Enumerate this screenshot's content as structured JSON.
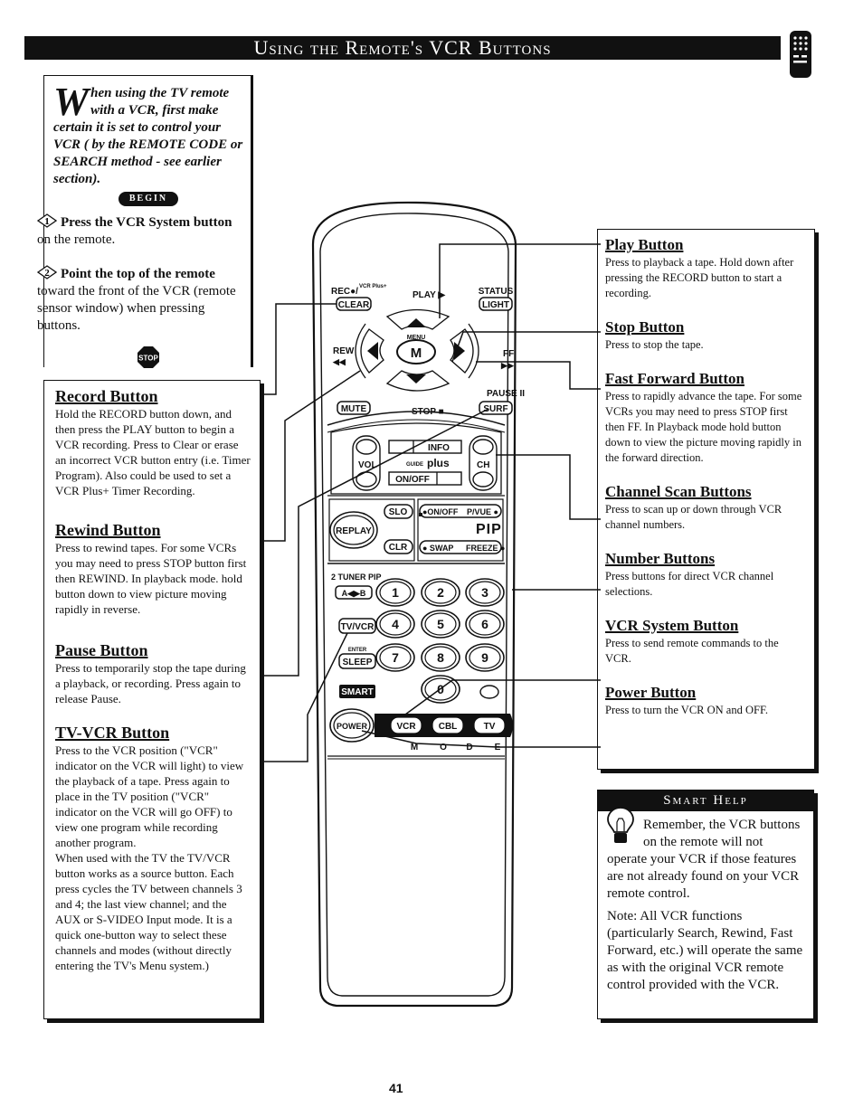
{
  "header": {
    "title": "Using the Remote's VCR Buttons",
    "icon": "remote-control-icon"
  },
  "intro": {
    "dropcap": "W",
    "text": "hen using the TV remote with a VCR, first make certain it is set to control your VCR ( by the REMOTE CODE or SEARCH method - see earlier section).",
    "begin_label": "BEGIN",
    "steps": [
      {
        "number": "1",
        "bold": "Press the VCR System button",
        "rest": " on the remote."
      },
      {
        "number": "2",
        "bold": "Point the top of the remote",
        "rest": " toward the front of the VCR (remote sensor window) when pressing buttons."
      }
    ],
    "stop_label": "STOP"
  },
  "left_sections": [
    {
      "title": "Record Button",
      "text": "Hold the RECORD button down, and then press the PLAY button to begin a VCR recording. Press to Clear or erase an incorrect VCR button entry (i.e. Timer Program). Also could be used to set a VCR Plus+ Timer Recording."
    },
    {
      "title": "Rewind Button",
      "text": "Press to rewind tapes. For some VCRs you may need to press STOP button first then REWIND. In playback mode. hold button down to view picture moving rapidly in reverse."
    },
    {
      "title": "Pause Button",
      "text": "Press to temporarily stop the tape during a playback, or recording. Press again to release Pause."
    },
    {
      "title": "TV-VCR Button",
      "text": "Press to the VCR position (\"VCR\" indicator on the VCR will light) to view the playback of a tape. Press again to place in the TV position (\"VCR\" indicator on the VCR will go OFF) to view one program while recording another program.",
      "text2": "When used with the TV the TV/VCR button works as a source button. Each press cycles the TV between channels 3 and 4; the last view channel; and the AUX or S-VIDEO Input mode. It is a quick one-button way to select these channels and modes (without directly entering the TV's Menu system.)"
    }
  ],
  "right_sections": [
    {
      "title": "Play Button",
      "text": "Press to playback a tape. Hold down after pressing the RECORD button to start a recording."
    },
    {
      "title": "Stop Button",
      "text": "Press to stop the tape."
    },
    {
      "title": "Fast Forward Button",
      "text": "Press to rapidly advance the tape. For some VCRs you may need to press STOP first then FF. In Playback mode hold button down to view the picture moving rapidly in the forward direction."
    },
    {
      "title": "Channel Scan Buttons",
      "text": "Press to scan up or down through VCR channel numbers."
    },
    {
      "title": "Number Buttons",
      "text": "Press buttons for direct VCR channel selections."
    },
    {
      "title": "VCR System Button",
      "text": "Press to send remote commands to the VCR."
    },
    {
      "title": "Power Button",
      "text": "Press to turn the VCR ON and OFF."
    }
  ],
  "smart_help": {
    "title": "Smart Help",
    "icon": "lightbulb-icon",
    "paragraph1": "Remember, the VCR buttons on the remote will not operate your VCR if those features are not already found on your VCR remote control.",
    "paragraph2": "Note: All VCR functions (particularly Search, Rewind, Fast Forward, etc.) will operate the same as with the original VCR remote control provided with the VCR."
  },
  "remote": {
    "rec_label": "REC●/",
    "vcr_plus_label": "VCR Plus+",
    "clear": "CLEAR",
    "play": "PLAY ▶",
    "status": "STATUS",
    "light": "LIGHT",
    "rew": "REW",
    "rew_glyph": "◀◀",
    "menu": "MENU",
    "m": "M",
    "ff": "FF",
    "ff_glyph": "▶▶",
    "pause": "PAUSE II",
    "mute": "MUTE",
    "stop": "STOP ■",
    "surf": "SURF",
    "vol": "VOL",
    "ch": "CH",
    "info": "INFO",
    "guide_small": "GUIDE",
    "guide_plus": "plus",
    "guide_onoff": "ON/OFF",
    "replay": "REPLAY",
    "slo": "SLO",
    "clr": "CLR",
    "pip_onoff": "●ON/OFF",
    "pip_pvue": "P/VUE ●",
    "pip": "PIP",
    "pip_swap": "● SWAP",
    "pip_freeze": "FREEZE ●",
    "tuner_pip": "2 TUNER PIP",
    "ab": "A◀▶B",
    "tvvcr": "TV/VCR",
    "enter": "ENTER",
    "sleep": "SLEEP",
    "smart": "SMART",
    "digits": [
      "1",
      "2",
      "3",
      "4",
      "5",
      "6",
      "7",
      "8",
      "9",
      "0"
    ],
    "power": "POWER",
    "mode_vcr": "VCR",
    "mode_cbl": "CBL",
    "mode_tv": "TV",
    "mode_letters": [
      "M",
      "O",
      "D",
      "E"
    ]
  },
  "page_number": "41"
}
